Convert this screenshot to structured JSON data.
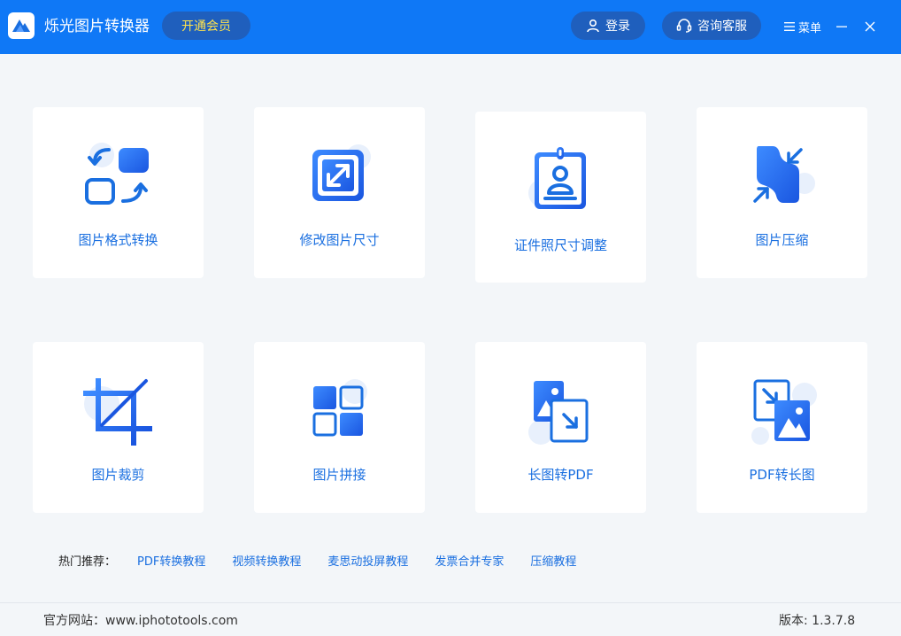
{
  "header": {
    "app_title": "烁光图片转换器",
    "vip_label": "开通会员",
    "login_label": "登录",
    "service_label": "咨询客服",
    "menu_label": "菜单"
  },
  "tools": [
    {
      "label": "图片格式转换",
      "icon": "format-convert-icon"
    },
    {
      "label": "修改图片尺寸",
      "icon": "resize-icon"
    },
    {
      "label": "证件照尺寸调整",
      "icon": "id-photo-icon"
    },
    {
      "label": "图片压缩",
      "icon": "compress-icon"
    },
    {
      "label": "图片裁剪",
      "icon": "crop-icon"
    },
    {
      "label": "图片拼接",
      "icon": "stitch-icon"
    },
    {
      "label": "长图转PDF",
      "icon": "image-to-pdf-icon"
    },
    {
      "label": "PDF转长图",
      "icon": "pdf-to-image-icon"
    }
  ],
  "hot": {
    "label": "热门推荐：",
    "links": [
      "PDF转换教程",
      "视频转换教程",
      "麦思动投屏教程",
      "发票合并专家",
      "压缩教程"
    ]
  },
  "footer": {
    "site_label": "官方网站：",
    "site_url": "www.iphototools.com",
    "version_label": "版本: ",
    "version": "1.3.7.8"
  },
  "colors": {
    "titlebar": "#0f78f6",
    "pill": "#1f5fbd",
    "vip_text": "#ffe34d",
    "accent": "#1a6fe0",
    "background": "#f3f6f9"
  }
}
